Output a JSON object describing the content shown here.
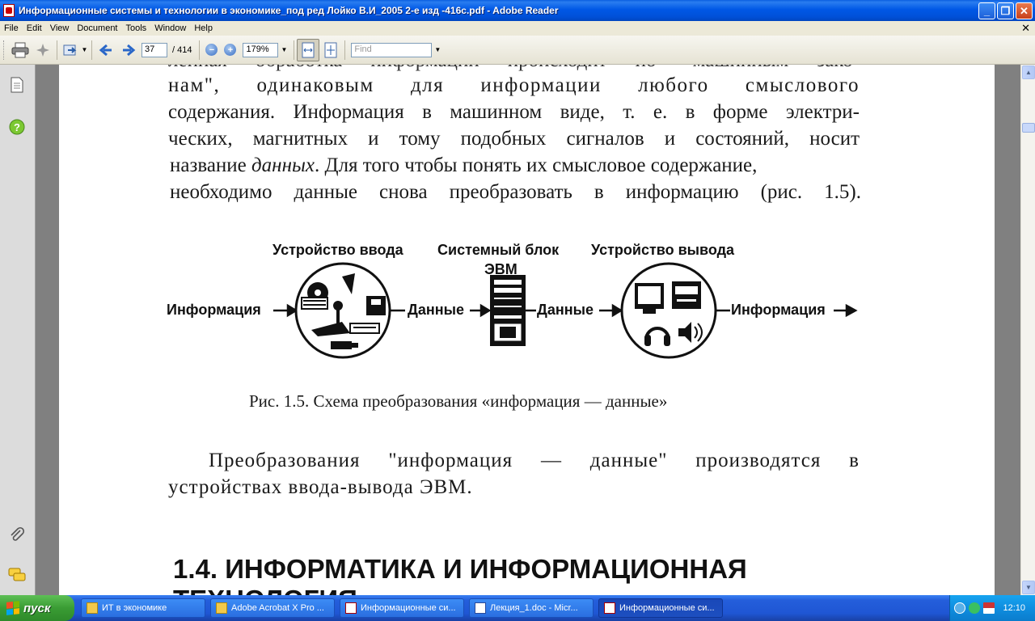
{
  "window": {
    "title": "Информационные системы и технологии в экономике_под ред Лойко В.И_2005 2-е изд -416с.pdf - Adobe Reader",
    "minimize": "_",
    "maximize": "❐",
    "close": "✕"
  },
  "menu": {
    "items": [
      "File",
      "Edit",
      "View",
      "Document",
      "Tools",
      "Window",
      "Help"
    ],
    "close_doc": "✕"
  },
  "toolbar": {
    "page_current": "37",
    "page_total": "/ 414",
    "zoom": "179%",
    "find_placeholder": "Find"
  },
  "document": {
    "lines": [
      "ленная обработка информации происходит по \"машинным зако-",
      "нам\", одинаковым для информации любого смыслового",
      "содержания. Информация в машинном виде, т. е. в форме электри-",
      "ческих, магнитных и тому подобных сигналов и состояний, носит",
      "название ",
      "данных",
      ". Для того чтобы понять их смысловое содержание,",
      "необходимо данные снова преобразовать в информацию (рис. 1.5)."
    ],
    "figure": {
      "label_input_device": "Устройство ввода",
      "label_system_unit_1": "Системный блок",
      "label_system_unit_2": "ЭВМ",
      "label_output_device": "Устройство вывода",
      "flow_info_in": "Информация",
      "flow_data_1": "Данные",
      "flow_data_2": "Данные",
      "flow_info_out": "Информация"
    },
    "caption": "Рис. 1.5. Схема преобразования «информация — данные»",
    "para2_line1": "Преобразования \"информация — данные\" производятся в",
    "para2_line2": "устройствах ввода-вывода ЭВМ.",
    "heading_line1": "1.4. ИНФОРМАТИКА И ИНФОРМАЦИОННАЯ",
    "heading_line2": "ТЕХНОЛОГИЯ"
  },
  "taskbar": {
    "start": "пуск",
    "tasks": [
      "ИТ в экономике",
      "Adobe Acrobat X Pro ...",
      "Информационные си...",
      "Лекция_1.doc - Micr...",
      "Информационные си..."
    ],
    "clock": "12:10"
  }
}
